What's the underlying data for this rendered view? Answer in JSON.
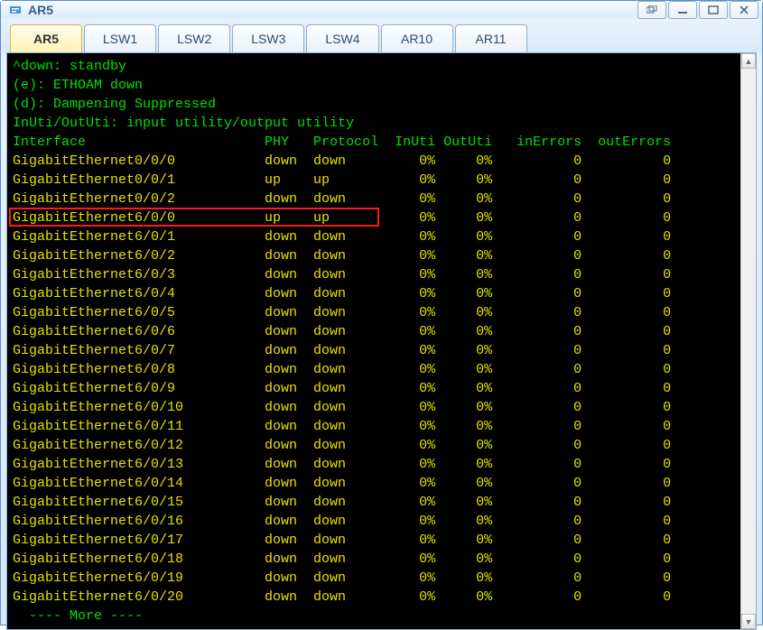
{
  "window": {
    "title": "AR5"
  },
  "tabs": [
    {
      "label": "AR5",
      "active": true
    },
    {
      "label": "LSW1",
      "active": false
    },
    {
      "label": "LSW2",
      "active": false
    },
    {
      "label": "LSW3",
      "active": false
    },
    {
      "label": "LSW4",
      "active": false
    },
    {
      "label": "AR10",
      "active": false
    },
    {
      "label": "AR11",
      "active": false
    }
  ],
  "terminal": {
    "pre_lines": [
      "^down: standby",
      "(e): ETHOAM down",
      "(d): Dampening Suppressed",
      "InUti/OutUti: input utility/output utility"
    ],
    "header": {
      "interface": "Interface",
      "phy": "PHY",
      "protocol": "Protocol",
      "inuti": "InUti",
      "oututi": "OutUti",
      "inerrors": "inErrors",
      "outerrors": "outErrors"
    },
    "rows": [
      {
        "if": "GigabitEthernet0/0/0",
        "phy": "down",
        "proto": "down",
        "in": "0%",
        "out": "0%",
        "ie": "0",
        "oe": "0",
        "hl": false
      },
      {
        "if": "GigabitEthernet0/0/1",
        "phy": "up",
        "proto": "up",
        "in": "0%",
        "out": "0%",
        "ie": "0",
        "oe": "0",
        "hl": false
      },
      {
        "if": "GigabitEthernet0/0/2",
        "phy": "down",
        "proto": "down",
        "in": "0%",
        "out": "0%",
        "ie": "0",
        "oe": "0",
        "hl": false
      },
      {
        "if": "GigabitEthernet6/0/0",
        "phy": "up",
        "proto": "up",
        "in": "0%",
        "out": "0%",
        "ie": "0",
        "oe": "0",
        "hl": true
      },
      {
        "if": "GigabitEthernet6/0/1",
        "phy": "down",
        "proto": "down",
        "in": "0%",
        "out": "0%",
        "ie": "0",
        "oe": "0",
        "hl": false
      },
      {
        "if": "GigabitEthernet6/0/2",
        "phy": "down",
        "proto": "down",
        "in": "0%",
        "out": "0%",
        "ie": "0",
        "oe": "0",
        "hl": false
      },
      {
        "if": "GigabitEthernet6/0/3",
        "phy": "down",
        "proto": "down",
        "in": "0%",
        "out": "0%",
        "ie": "0",
        "oe": "0",
        "hl": false
      },
      {
        "if": "GigabitEthernet6/0/4",
        "phy": "down",
        "proto": "down",
        "in": "0%",
        "out": "0%",
        "ie": "0",
        "oe": "0",
        "hl": false
      },
      {
        "if": "GigabitEthernet6/0/5",
        "phy": "down",
        "proto": "down",
        "in": "0%",
        "out": "0%",
        "ie": "0",
        "oe": "0",
        "hl": false
      },
      {
        "if": "GigabitEthernet6/0/6",
        "phy": "down",
        "proto": "down",
        "in": "0%",
        "out": "0%",
        "ie": "0",
        "oe": "0",
        "hl": false
      },
      {
        "if": "GigabitEthernet6/0/7",
        "phy": "down",
        "proto": "down",
        "in": "0%",
        "out": "0%",
        "ie": "0",
        "oe": "0",
        "hl": false
      },
      {
        "if": "GigabitEthernet6/0/8",
        "phy": "down",
        "proto": "down",
        "in": "0%",
        "out": "0%",
        "ie": "0",
        "oe": "0",
        "hl": false
      },
      {
        "if": "GigabitEthernet6/0/9",
        "phy": "down",
        "proto": "down",
        "in": "0%",
        "out": "0%",
        "ie": "0",
        "oe": "0",
        "hl": false
      },
      {
        "if": "GigabitEthernet6/0/10",
        "phy": "down",
        "proto": "down",
        "in": "0%",
        "out": "0%",
        "ie": "0",
        "oe": "0",
        "hl": false
      },
      {
        "if": "GigabitEthernet6/0/11",
        "phy": "down",
        "proto": "down",
        "in": "0%",
        "out": "0%",
        "ie": "0",
        "oe": "0",
        "hl": false
      },
      {
        "if": "GigabitEthernet6/0/12",
        "phy": "down",
        "proto": "down",
        "in": "0%",
        "out": "0%",
        "ie": "0",
        "oe": "0",
        "hl": false
      },
      {
        "if": "GigabitEthernet6/0/13",
        "phy": "down",
        "proto": "down",
        "in": "0%",
        "out": "0%",
        "ie": "0",
        "oe": "0",
        "hl": false
      },
      {
        "if": "GigabitEthernet6/0/14",
        "phy": "down",
        "proto": "down",
        "in": "0%",
        "out": "0%",
        "ie": "0",
        "oe": "0",
        "hl": false
      },
      {
        "if": "GigabitEthernet6/0/15",
        "phy": "down",
        "proto": "down",
        "in": "0%",
        "out": "0%",
        "ie": "0",
        "oe": "0",
        "hl": false
      },
      {
        "if": "GigabitEthernet6/0/16",
        "phy": "down",
        "proto": "down",
        "in": "0%",
        "out": "0%",
        "ie": "0",
        "oe": "0",
        "hl": false
      },
      {
        "if": "GigabitEthernet6/0/17",
        "phy": "down",
        "proto": "down",
        "in": "0%",
        "out": "0%",
        "ie": "0",
        "oe": "0",
        "hl": false
      },
      {
        "if": "GigabitEthernet6/0/18",
        "phy": "down",
        "proto": "down",
        "in": "0%",
        "out": "0%",
        "ie": "0",
        "oe": "0",
        "hl": false
      },
      {
        "if": "GigabitEthernet6/0/19",
        "phy": "down",
        "proto": "down",
        "in": "0%",
        "out": "0%",
        "ie": "0",
        "oe": "0",
        "hl": false
      },
      {
        "if": "GigabitEthernet6/0/20",
        "phy": "down",
        "proto": "down",
        "in": "0%",
        "out": "0%",
        "ie": "0",
        "oe": "0",
        "hl": false
      }
    ],
    "more_prompt": "  ---- More ----"
  }
}
